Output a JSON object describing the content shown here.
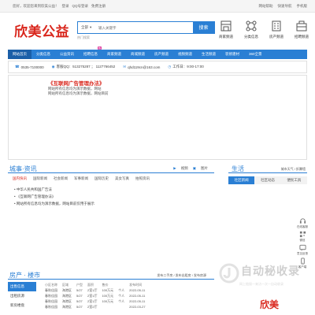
{
  "topbar": {
    "greeting": "您好，欢迎您来到欣美公益！",
    "login": "登录",
    "qq_login": "QQ号登录",
    "register": "免费注册",
    "help": "网站帮助",
    "phone_version": "手机版",
    "quick_nav": "快速导航"
  },
  "header": {
    "logo": "欣美公益",
    "search": {
      "scope": "全部",
      "placeholder": "输入关键字",
      "button": "搜索"
    },
    "hot_label": "热门搜索",
    "icons": [
      {
        "label": "商家频道",
        "icon": "shop-icon"
      },
      {
        "label": "分类信息",
        "icon": "classified-icon"
      },
      {
        "label": "房产频道",
        "icon": "house-icon"
      },
      {
        "label": "招聘频道",
        "icon": "jobs-icon"
      }
    ]
  },
  "nav": {
    "items": [
      {
        "label": "网站首页",
        "active": true
      },
      {
        "label": "分类信息"
      },
      {
        "label": "公益资讯"
      },
      {
        "label": "招聘信息",
        "badge": "热"
      },
      {
        "label": "商家频道"
      },
      {
        "label": "商城频道"
      },
      {
        "label": "房产频道"
      },
      {
        "label": "视频频道"
      },
      {
        "label": "生活频道"
      },
      {
        "label": "装修建材"
      },
      {
        "label": "360全景"
      }
    ]
  },
  "contact": {
    "phone": "0535-7100000",
    "qq": "客服QQ：513275287 ； 1127766452",
    "email": "qhd119cn@163.com",
    "hours": "工作日：9:00-17:00"
  },
  "content": {
    "title": "《互联网广告管理办法》",
    "line1": "网站所有信息均为演示数据，网站",
    "line2": "网站所有信息均为演示数据，网站目前"
  },
  "news": {
    "title": "城事·资讯",
    "video_label": "视频",
    "image_label": "图片",
    "tabs": [
      "国内快讯",
      "国际新闻",
      "社会新闻",
      "军事新闻",
      "国际历史",
      "美女写真",
      "拍照资讯"
    ],
    "items": [
      "• 中华人民共和国广告法",
      "• 《互联网广告管理办法》",
      "• 网站所有信息均为演示数据，网站目前仅用于展示"
    ]
  },
  "life": {
    "title": "生活",
    "right": "城市天气 / 折腾墙",
    "tabs": [
      "社区新闻",
      "社区动态",
      "便民工具"
    ]
  },
  "realestate": {
    "title": "房产 · 楼市",
    "right": "发布二手房 / 发布出租房 / 发布房源",
    "side": [
      "出售信息",
      "出租房源",
      "新房楼盘"
    ],
    "headers": [
      "小区名称",
      "区域",
      "户型",
      "面积",
      "售价",
      "",
      "发布时间"
    ],
    "rows": [
      [
        "春秋佳园",
        "海港区",
        "5/27",
        "2室1厅",
        "100万元",
        "个人",
        "2022-05-11"
      ],
      [
        "春秋佳园",
        "海港区",
        "5/27",
        "2室1厅",
        "100万元",
        "个人",
        "2022-05-11"
      ],
      [
        "春秋佳园",
        "海港区",
        "5/27",
        "2室1厅",
        "100万元",
        "个人",
        "2022-05-11"
      ],
      [
        "春秋佳园",
        "海港区",
        "5/27",
        "2室2厅",
        "",
        "",
        "2022-03-27"
      ]
    ]
  },
  "toolbar": {
    "items": [
      {
        "label": "在线客服",
        "icon": "headset-icon"
      },
      {
        "label": "微信",
        "icon": "qrcode-icon"
      },
      {
        "label": "意见反馈",
        "icon": "feedback-icon"
      },
      {
        "label": "客户端",
        "icon": "phone-icon"
      }
    ]
  },
  "watermark": {
    "text": "自动秘收录",
    "sub": "网上链接一来访一次一自动收录"
  },
  "bottom_logo": "欣美"
}
